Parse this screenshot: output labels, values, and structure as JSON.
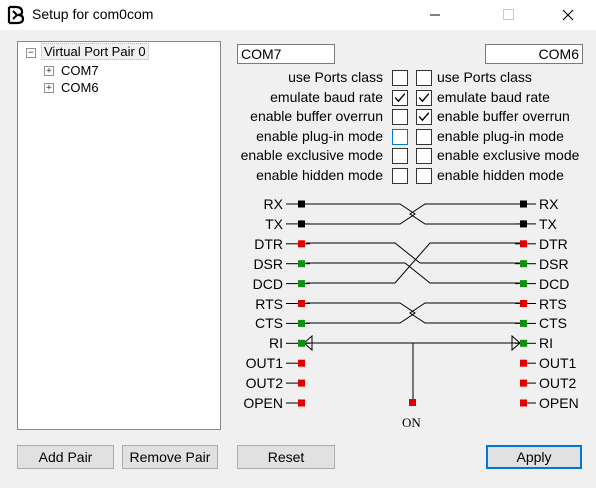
{
  "window": {
    "title": "Setup for com0com"
  },
  "tree": {
    "root": "Virtual Port Pair 0",
    "children": [
      "COM7",
      "COM6"
    ]
  },
  "left": {
    "port_name": "COM7"
  },
  "right": {
    "port_name": "COM6"
  },
  "options": [
    {
      "label": "use Ports class",
      "left_checked": false,
      "right_checked": false
    },
    {
      "label": "emulate baud rate",
      "left_checked": true,
      "right_checked": true
    },
    {
      "label": "enable buffer overrun",
      "left_checked": false,
      "right_checked": true
    },
    {
      "label": "enable plug-in mode",
      "left_checked": false,
      "right_checked": false
    },
    {
      "label": "enable exclusive mode",
      "left_checked": false,
      "right_checked": false
    },
    {
      "label": "enable hidden mode",
      "left_checked": false,
      "right_checked": false
    }
  ],
  "pins": [
    "RX",
    "TX",
    "DTR",
    "DSR",
    "DCD",
    "RTS",
    "CTS",
    "RI",
    "OUT1",
    "OUT2",
    "OPEN"
  ],
  "pin_on_label": "ON",
  "colors": {
    "black_pin": "#000000",
    "red_pin": "#e00000",
    "green_pin": "#109010",
    "accent": "#0078d7"
  },
  "buttons": {
    "add_pair": "Add Pair",
    "remove_pair": "Remove Pair",
    "reset": "Reset",
    "apply": "Apply"
  }
}
